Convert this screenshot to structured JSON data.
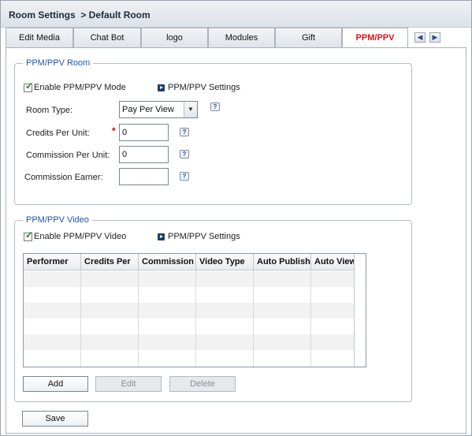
{
  "window": {
    "title": "Room Settings",
    "breadcrumb": "> Default Room"
  },
  "tabs": [
    {
      "label": "Edit Media",
      "active": false
    },
    {
      "label": "Chat Bot",
      "active": false
    },
    {
      "label": "logo",
      "active": false
    },
    {
      "label": "Modules",
      "active": false
    },
    {
      "label": "Gift",
      "active": false
    },
    {
      "label": "PPM/PPV",
      "active": true
    }
  ],
  "tab_nav": {
    "prev_icon": "arrow-left-icon",
    "next_icon": "arrow-right-icon"
  },
  "room_group": {
    "legend": "PPM/PPV Room",
    "enable_label": "Enable PPM/PPV Mode",
    "enable_checked": true,
    "settings_link": "PPM/PPV Settings",
    "room_type_label": "Room Type:",
    "room_type_value": "Pay Per View",
    "credits_label": "Credits Per Unit:",
    "credits_value": "0",
    "commission_label": "Commission Per Unit:",
    "commission_value": "0",
    "earner_label": "Commission Earner:",
    "earner_value": "",
    "help_glyph": "?",
    "required_marker": "*"
  },
  "video_group": {
    "legend": "PPM/PPV Video",
    "enable_label": "Enable PPM/PPV Video",
    "enable_checked": true,
    "settings_link": "PPM/PPV Settings",
    "columns": [
      "Performer",
      "Credits Per",
      "Commission",
      "Video Type",
      "Auto Publish",
      "Auto View"
    ],
    "rows": [],
    "add_label": "Add",
    "edit_label": "Edit",
    "delete_label": "Delete"
  },
  "save_label": "Save",
  "colors": {
    "active_tab": "#e0141b",
    "legend": "#1d56b8",
    "required": "#d0021b"
  }
}
